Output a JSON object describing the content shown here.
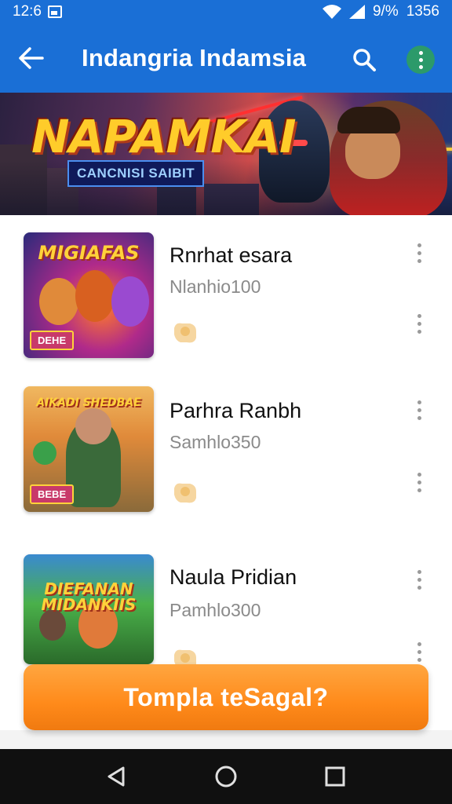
{
  "status_bar": {
    "time": "12:6",
    "battery": "9/%",
    "clock_right": "1356"
  },
  "app_bar": {
    "title": "Indangria Indamsia",
    "icons": {
      "back": "arrow-left-icon",
      "search": "search-icon",
      "menu": "more-vert-icon"
    }
  },
  "banner": {
    "title": "NAPAMKAI",
    "tag": "CANCNISI SAIBIT"
  },
  "list": {
    "items": [
      {
        "title": "Rnrhat esara",
        "subtitle": "Nlanhio100",
        "thumb_title": "MIGIAFAS",
        "thumb_badge": "DEHE"
      },
      {
        "title": "Parhra Ranbh",
        "subtitle": "Samhlo350",
        "thumb_title": "AIKADI SHEDBAE",
        "thumb_badge": "BEBE"
      },
      {
        "title": "Naula Pridian",
        "subtitle": "Pamhlo300",
        "thumb_title": "DIEFANAN MIDANKIIS",
        "thumb_badge": ""
      }
    ]
  },
  "cta": {
    "label": "Tompla teSagal?"
  },
  "colors": {
    "primary": "#1a6fd6",
    "accent": "#ff8a1a"
  }
}
